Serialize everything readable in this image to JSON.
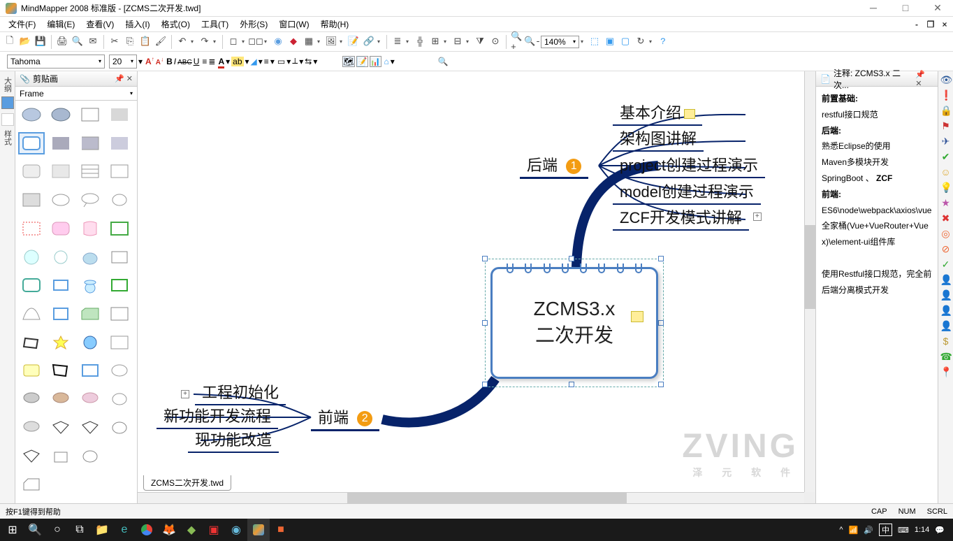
{
  "titlebar": {
    "title": "MindMapper 2008 标准版 - [ZCMS二次开发.twd]"
  },
  "menus": [
    "文件(F)",
    "编辑(E)",
    "查看(V)",
    "插入(I)",
    "格式(O)",
    "工具(T)",
    "外形(S)",
    "窗口(W)",
    "帮助(H)"
  ],
  "font": {
    "name": "Tahoma",
    "size": "20"
  },
  "zoom": "140%",
  "clip_panel": {
    "title": "剪贴画",
    "dropdown": "Frame"
  },
  "central": {
    "line1": "ZCMS3.x",
    "line2": "二次开发"
  },
  "backend": {
    "label": "后端",
    "num": "1",
    "children": [
      "基本介绍",
      "架构图讲解",
      "project创建过程演示",
      "model创建过程演示",
      "ZCF开发模式讲解"
    ]
  },
  "frontend": {
    "label": "前端",
    "num": "2",
    "children": [
      "工程初始化",
      "新功能开发流程",
      "现功能改造"
    ]
  },
  "tab_name": "ZCMS二次开发.twd",
  "notes": {
    "title": "注释: ZCMS3.x 二次...",
    "lines": [
      "前置基础:",
      "restful接口规范",
      "后端:",
      "熟悉Eclipse的使用",
      "Maven多模块开发",
      "SpringBoot 、  ZCF",
      "前端:",
      "ES6\\node\\webpack\\axios\\vue全家桶(Vue+VueRouter+Vuex)\\element-ui组件库",
      "",
      "使用Restful接口规范，完全前后端分离模式开发"
    ]
  },
  "status": {
    "help": "按F1键得到帮助",
    "cap": "CAP",
    "num": "NUM",
    "scrl": "SCRL"
  },
  "tray": {
    "ime": "中",
    "time": "1:14"
  },
  "watermark": {
    "text": "ZVING",
    "sub": "泽 元 软 件"
  }
}
